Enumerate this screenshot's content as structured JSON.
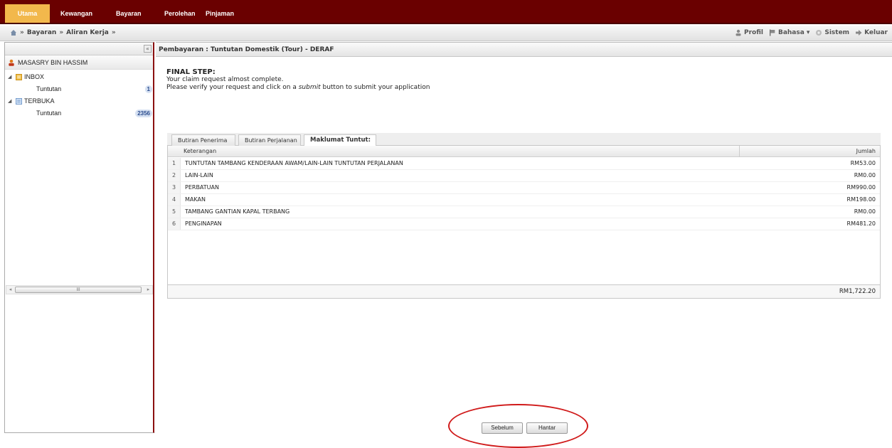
{
  "top_menu": [
    {
      "label": "Utama",
      "active": true
    },
    {
      "label": "Kewangan",
      "active": false
    },
    {
      "label": "Bayaran",
      "active": false
    },
    {
      "label": "Perolehan",
      "active": false
    },
    {
      "label": "Pinjaman",
      "active": false
    }
  ],
  "breadcrumb": {
    "home_icon": "home-icon",
    "items": [
      "Bayaran",
      "Aliran Kerja"
    ]
  },
  "toolbar_right": {
    "profil": "Profil",
    "bahasa": "Bahasa",
    "sistem": "Sistem",
    "keluar": "Keluar"
  },
  "sidebar": {
    "user": "MASASRY BIN HASSIM",
    "tree": [
      {
        "label": "INBOX",
        "children": [
          {
            "label": "Tuntutan",
            "count": "1"
          }
        ]
      },
      {
        "label": "TERBUKA",
        "children": [
          {
            "label": "Tuntutan",
            "count": "2356"
          }
        ]
      }
    ]
  },
  "main": {
    "title": "Pembayaran : Tuntutan Domestik (Tour) - DERAF",
    "final_step": {
      "title": "FINAL STEP:",
      "line1": "Your claim request almost complete.",
      "line2_pre": "Please verify your request and click on a ",
      "line2_em": "submit",
      "line2_post": " button to submit your application"
    },
    "tabs": [
      "Butiran Penerima",
      "Butiran Perjalanan",
      "Maklumat Tuntut:"
    ],
    "active_tab": 2,
    "grid": {
      "headers": {
        "desc": "Keterangan",
        "amount": "Jumlah"
      },
      "rows": [
        {
          "no": "1",
          "desc": "TUNTUTAN TAMBANG KENDERAAN AWAM/LAIN-LAIN TUNTUTAN PERJALANAN",
          "amount": "RM53.00"
        },
        {
          "no": "2",
          "desc": "LAIN-LAIN",
          "amount": "RM0.00"
        },
        {
          "no": "3",
          "desc": "PERBATUAN",
          "amount": "RM990.00"
        },
        {
          "no": "4",
          "desc": "MAKAN",
          "amount": "RM198.00"
        },
        {
          "no": "5",
          "desc": "TAMBANG GANTIAN KAPAL TERBANG",
          "amount": "RM0.00"
        },
        {
          "no": "6",
          "desc": "PENGINAPAN",
          "amount": "RM481.20"
        }
      ],
      "total": "RM1,722.20"
    },
    "buttons": {
      "back": "Sebelum",
      "submit": "Hantar"
    }
  },
  "colors": {
    "brand": "#6a0000",
    "active_menu": "#f2b84c",
    "highlight": "#d01a1a"
  }
}
